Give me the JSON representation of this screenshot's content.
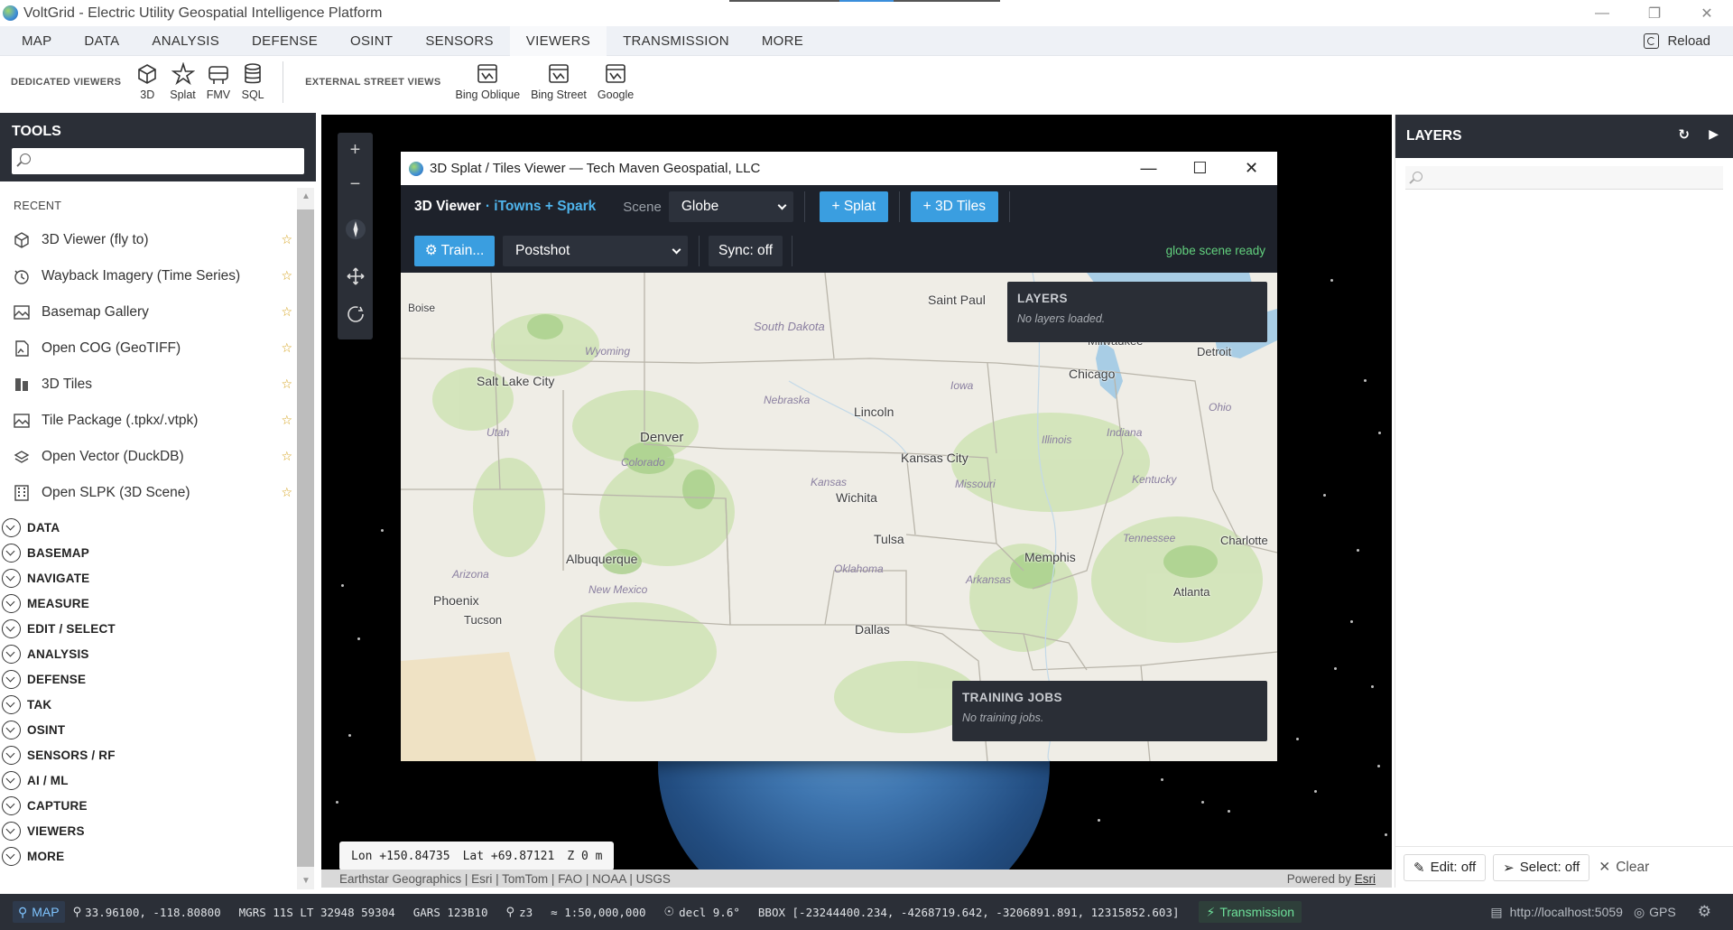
{
  "window": {
    "title": "VoltGrid - Electric Utility Geospatial Intelligence Platform"
  },
  "menu": {
    "items": [
      "MAP",
      "DATA",
      "ANALYSIS",
      "DEFENSE",
      "OSINT",
      "SENSORS",
      "VIEWERS",
      "TRANSMISSION",
      "MORE"
    ],
    "active": "VIEWERS",
    "reload_label": "Reload"
  },
  "ribbon": {
    "dedicated_label": "DEDICATED VIEWERS",
    "dedicated": [
      {
        "label": "3D",
        "icon": "cube-icon"
      },
      {
        "label": "Splat",
        "icon": "splat-icon"
      },
      {
        "label": "FMV",
        "icon": "fmv-icon"
      },
      {
        "label": "SQL",
        "icon": "database-icon"
      }
    ],
    "external_label": "EXTERNAL STREET VIEWS",
    "external": [
      {
        "label": "Bing Oblique",
        "icon": "map-book-icon"
      },
      {
        "label": "Bing Street",
        "icon": "map-book-icon"
      },
      {
        "label": "Google",
        "icon": "map-book-icon"
      }
    ]
  },
  "tools": {
    "title": "TOOLS",
    "search_placeholder": "",
    "recent_label": "RECENT",
    "recent": [
      {
        "label": "3D Viewer (fly to)",
        "icon": "cube-icon"
      },
      {
        "label": "Wayback Imagery (Time Series)",
        "icon": "history-icon"
      },
      {
        "label": "Basemap Gallery",
        "icon": "gallery-icon"
      },
      {
        "label": "Open COG (GeoTIFF)",
        "icon": "file-image-icon"
      },
      {
        "label": "3D Tiles",
        "icon": "tiles-icon"
      },
      {
        "label": "Tile Package (.tpkx/.vtpk)",
        "icon": "package-icon"
      },
      {
        "label": "Open Vector (DuckDB)",
        "icon": "vector-icon"
      },
      {
        "label": "Open SLPK (3D Scene)",
        "icon": "building-icon"
      }
    ],
    "categories": [
      "DATA",
      "BASEMAP",
      "NAVIGATE",
      "MEASURE",
      "EDIT / SELECT",
      "ANALYSIS",
      "DEFENSE",
      "TAK",
      "OSINT",
      "SENSORS / RF",
      "AI / ML",
      "CAPTURE",
      "VIEWERS",
      "MORE"
    ]
  },
  "map": {
    "coords": {
      "lon": "Lon +150.84735",
      "lat": "Lat +69.87121",
      "z": "Z 0 m"
    },
    "attribution": "Earthstar Geographics | Esri | TomTom | FAO | NOAA | USGS",
    "powered_by": "Powered by",
    "esri": "Esri"
  },
  "viewer": {
    "title": "3D Splat / Tiles Viewer — Tech Maven Geospatial, LLC",
    "heading": "3D Viewer",
    "subheading": "· iTowns + Spark",
    "scene_label": "Scene",
    "scene_value": "Globe",
    "add_splat": "+ Splat",
    "add_tiles": "+ 3D Tiles",
    "train_label": "⚙ Train...",
    "engine_value": "Postshot",
    "sync_label": "Sync: off",
    "status": "globe scene ready",
    "layers_title": "LAYERS",
    "layers_empty": "No layers loaded.",
    "jobs_title": "TRAINING JOBS",
    "jobs_empty": "No training jobs.",
    "basemap_labels": [
      {
        "text": "Saint Paul",
        "italic": false
      },
      {
        "text": "South Dakota",
        "italic": true
      },
      {
        "text": "Boise",
        "italic": false
      },
      {
        "text": "Wyoming",
        "italic": true
      },
      {
        "text": "Milwaukee",
        "italic": false
      },
      {
        "text": "Detroit",
        "italic": false
      },
      {
        "text": "Chicago",
        "italic": false
      },
      {
        "text": "Iowa",
        "italic": true
      },
      {
        "text": "Salt Lake City",
        "italic": false
      },
      {
        "text": "Nebraska",
        "italic": true
      },
      {
        "text": "Lincoln",
        "italic": false
      },
      {
        "text": "Ohio",
        "italic": true
      },
      {
        "text": "Utah",
        "italic": true
      },
      {
        "text": "Denver",
        "italic": false
      },
      {
        "text": "Illinois",
        "italic": true
      },
      {
        "text": "Indiana",
        "italic": true
      },
      {
        "text": "Colorado",
        "italic": true
      },
      {
        "text": "Kansas City",
        "italic": false
      },
      {
        "text": "Kansas",
        "italic": true
      },
      {
        "text": "Missouri",
        "italic": true
      },
      {
        "text": "Kentucky",
        "italic": true
      },
      {
        "text": "Wichita",
        "italic": false
      },
      {
        "text": "Tulsa",
        "italic": false
      },
      {
        "text": "Tennessee",
        "italic": true
      },
      {
        "text": "Charlotte",
        "italic": false
      },
      {
        "text": "Albuquerque",
        "italic": false
      },
      {
        "text": "Oklahoma",
        "italic": true
      },
      {
        "text": "Memphis",
        "italic": false
      },
      {
        "text": "Arizona",
        "italic": true
      },
      {
        "text": "Arkansas",
        "italic": true
      },
      {
        "text": "New Mexico",
        "italic": true
      },
      {
        "text": "Atlanta",
        "italic": false
      },
      {
        "text": "Phoenix",
        "italic": false
      },
      {
        "text": "Tucson",
        "italic": false
      },
      {
        "text": "Dallas",
        "italic": false
      }
    ]
  },
  "layers": {
    "title": "LAYERS",
    "edit_label": "Edit: off",
    "select_label": "Select: off",
    "clear_label": "Clear"
  },
  "status": {
    "map_label": "MAP",
    "latlon": "33.96100, -118.80800",
    "mgrs": "MGRS 11S LT 32948 59304",
    "gars": "GARS 123B10",
    "zoom": "z3",
    "scale": "≈ 1:50,000,000",
    "decl": "decl 9.6°",
    "bbox": "BBOX [-23244400.234, -4268719.642, -3206891.891, 12315852.603]",
    "transmission": "Transmission",
    "server": "http://localhost:5059",
    "gps": "GPS"
  },
  "colors": {
    "panel_dark": "#2b2f37",
    "accent_blue": "#3a9ee0",
    "status_green": "#62d17e"
  }
}
